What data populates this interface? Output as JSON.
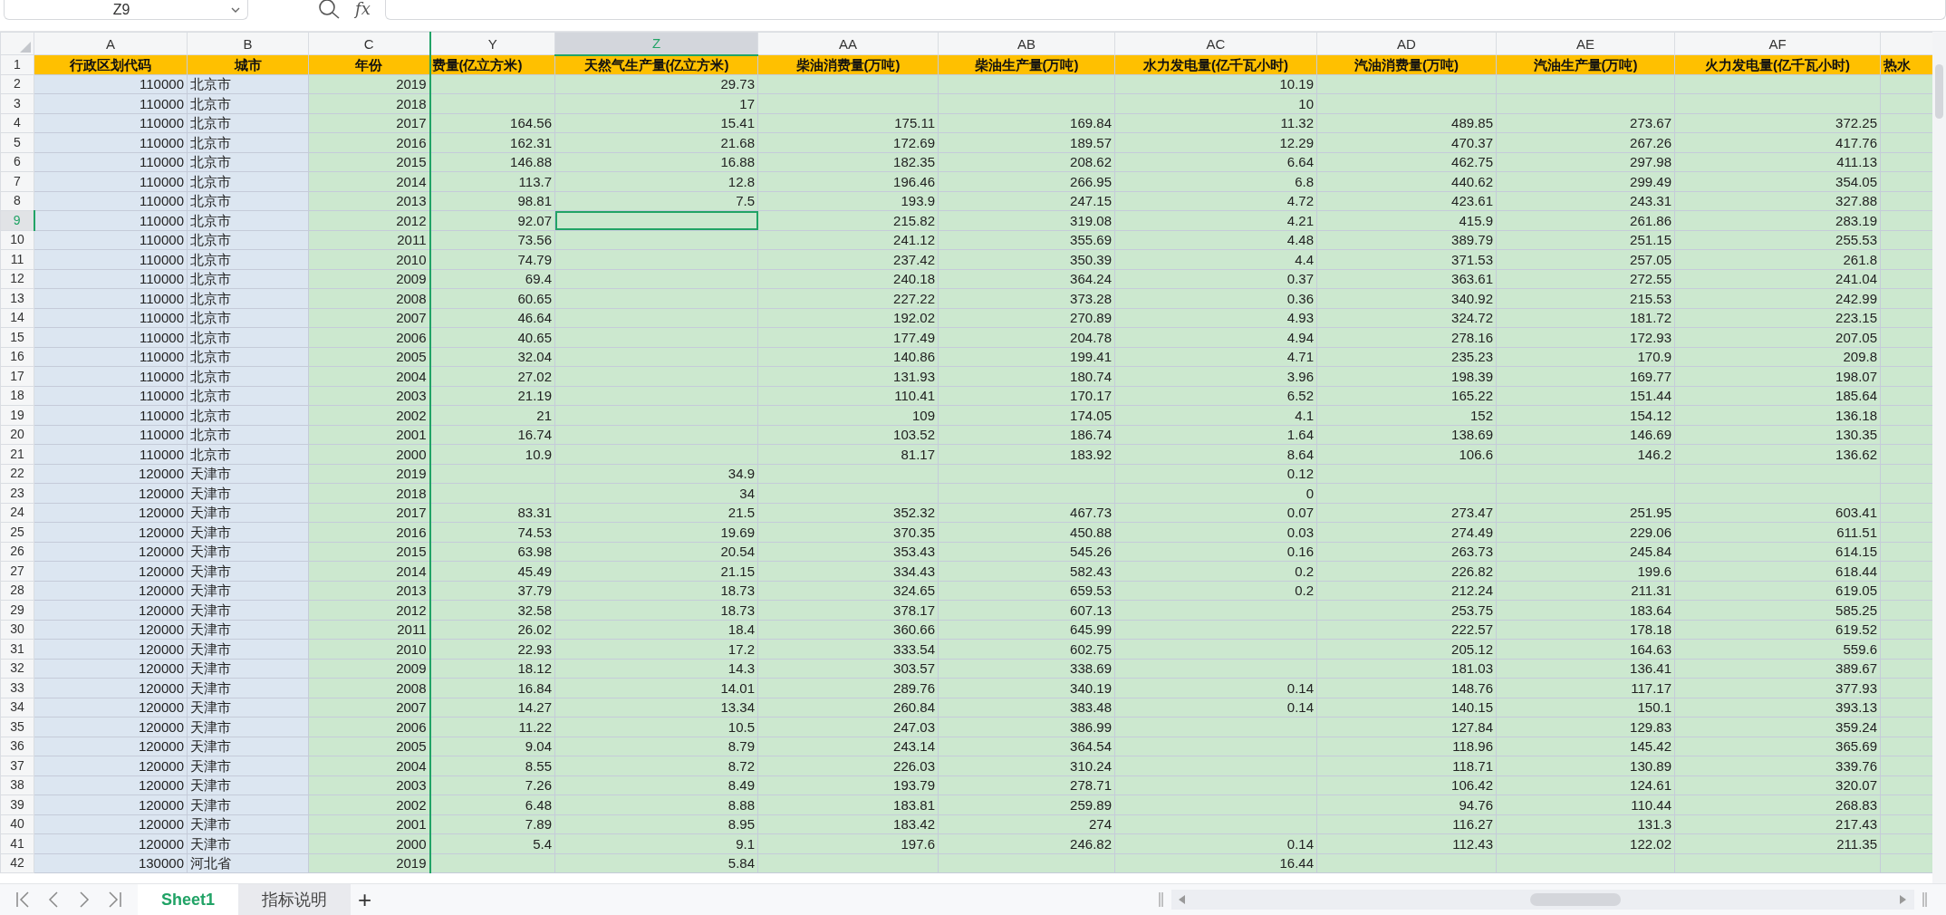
{
  "name_box": {
    "value": "Z9"
  },
  "formula_label": "fx",
  "columns": [
    {
      "letter": "A",
      "selected": false
    },
    {
      "letter": "B",
      "selected": false
    },
    {
      "letter": "C",
      "selected": false
    },
    {
      "letter": "Y",
      "selected": false
    },
    {
      "letter": "Z",
      "selected": true
    },
    {
      "letter": "AA",
      "selected": false
    },
    {
      "letter": "AB",
      "selected": false
    },
    {
      "letter": "AC",
      "selected": false
    },
    {
      "letter": "AD",
      "selected": false
    },
    {
      "letter": "AE",
      "selected": false
    },
    {
      "letter": "AF",
      "selected": false
    }
  ],
  "header_row": {
    "number": "1",
    "cells": [
      "行政区划代码",
      "城市",
      "年份",
      "费量(亿立方米)",
      "天然气生产量(亿立方米)",
      "柴油消费量(万吨)",
      "柴油生产量(万吨)",
      "水力发电量(亿千瓦小时)",
      "汽油消费量(万吨)",
      "汽油生产量(万吨)",
      "火力发电量(亿千瓦小时)",
      "热水"
    ]
  },
  "rows": [
    {
      "number": "2",
      "selected": false,
      "cells": [
        "110000",
        "北京市",
        "2019",
        null,
        "29.73",
        null,
        null,
        "10.19",
        null,
        null,
        null
      ]
    },
    {
      "number": "3",
      "selected": false,
      "cells": [
        "110000",
        "北京市",
        "2018",
        null,
        "17",
        null,
        null,
        "10",
        null,
        null,
        null
      ]
    },
    {
      "number": "4",
      "selected": false,
      "cells": [
        "110000",
        "北京市",
        "2017",
        "164.56",
        "15.41",
        "175.11",
        "169.84",
        "11.32",
        "489.85",
        "273.67",
        "372.25"
      ]
    },
    {
      "number": "5",
      "selected": false,
      "cells": [
        "110000",
        "北京市",
        "2016",
        "162.31",
        "21.68",
        "172.69",
        "189.57",
        "12.29",
        "470.37",
        "267.26",
        "417.76"
      ]
    },
    {
      "number": "6",
      "selected": false,
      "cells": [
        "110000",
        "北京市",
        "2015",
        "146.88",
        "16.88",
        "182.35",
        "208.62",
        "6.64",
        "462.75",
        "297.98",
        "411.13"
      ]
    },
    {
      "number": "7",
      "selected": false,
      "cells": [
        "110000",
        "北京市",
        "2014",
        "113.7",
        "12.8",
        "196.46",
        "266.95",
        "6.8",
        "440.62",
        "299.49",
        "354.05"
      ]
    },
    {
      "number": "8",
      "selected": false,
      "cells": [
        "110000",
        "北京市",
        "2013",
        "98.81",
        "7.5",
        "193.9",
        "247.15",
        "4.72",
        "423.61",
        "243.31",
        "327.88"
      ]
    },
    {
      "number": "9",
      "selected": true,
      "cells": [
        "110000",
        "北京市",
        "2012",
        "92.07",
        null,
        "215.82",
        "319.08",
        "4.21",
        "415.9",
        "261.86",
        "283.19"
      ]
    },
    {
      "number": "10",
      "selected": false,
      "cells": [
        "110000",
        "北京市",
        "2011",
        "73.56",
        null,
        "241.12",
        "355.69",
        "4.48",
        "389.79",
        "251.15",
        "255.53"
      ]
    },
    {
      "number": "11",
      "selected": false,
      "cells": [
        "110000",
        "北京市",
        "2010",
        "74.79",
        null,
        "237.42",
        "350.39",
        "4.4",
        "371.53",
        "257.05",
        "261.8"
      ]
    },
    {
      "number": "12",
      "selected": false,
      "cells": [
        "110000",
        "北京市",
        "2009",
        "69.4",
        null,
        "240.18",
        "364.24",
        "0.37",
        "363.61",
        "272.55",
        "241.04"
      ]
    },
    {
      "number": "13",
      "selected": false,
      "cells": [
        "110000",
        "北京市",
        "2008",
        "60.65",
        null,
        "227.22",
        "373.28",
        "0.36",
        "340.92",
        "215.53",
        "242.99"
      ]
    },
    {
      "number": "14",
      "selected": false,
      "cells": [
        "110000",
        "北京市",
        "2007",
        "46.64",
        null,
        "192.02",
        "270.89",
        "4.93",
        "324.72",
        "181.72",
        "223.15"
      ]
    },
    {
      "number": "15",
      "selected": false,
      "cells": [
        "110000",
        "北京市",
        "2006",
        "40.65",
        null,
        "177.49",
        "204.78",
        "4.94",
        "278.16",
        "172.93",
        "207.05"
      ]
    },
    {
      "number": "16",
      "selected": false,
      "cells": [
        "110000",
        "北京市",
        "2005",
        "32.04",
        null,
        "140.86",
        "199.41",
        "4.71",
        "235.23",
        "170.9",
        "209.8"
      ]
    },
    {
      "number": "17",
      "selected": false,
      "cells": [
        "110000",
        "北京市",
        "2004",
        "27.02",
        null,
        "131.93",
        "180.74",
        "3.96",
        "198.39",
        "169.77",
        "198.07"
      ]
    },
    {
      "number": "18",
      "selected": false,
      "cells": [
        "110000",
        "北京市",
        "2003",
        "21.19",
        null,
        "110.41",
        "170.17",
        "6.52",
        "165.22",
        "151.44",
        "185.64"
      ]
    },
    {
      "number": "19",
      "selected": false,
      "cells": [
        "110000",
        "北京市",
        "2002",
        "21",
        null,
        "109",
        "174.05",
        "4.1",
        "152",
        "154.12",
        "136.18"
      ]
    },
    {
      "number": "20",
      "selected": false,
      "cells": [
        "110000",
        "北京市",
        "2001",
        "16.74",
        null,
        "103.52",
        "186.74",
        "1.64",
        "138.69",
        "146.69",
        "130.35"
      ]
    },
    {
      "number": "21",
      "selected": false,
      "cells": [
        "110000",
        "北京市",
        "2000",
        "10.9",
        null,
        "81.17",
        "183.92",
        "8.64",
        "106.6",
        "146.2",
        "136.62"
      ]
    },
    {
      "number": "22",
      "selected": false,
      "cells": [
        "120000",
        "天津市",
        "2019",
        null,
        "34.9",
        null,
        null,
        "0.12",
        null,
        null,
        null
      ]
    },
    {
      "number": "23",
      "selected": false,
      "cells": [
        "120000",
        "天津市",
        "2018",
        null,
        "34",
        null,
        null,
        "0",
        null,
        null,
        null
      ]
    },
    {
      "number": "24",
      "selected": false,
      "cells": [
        "120000",
        "天津市",
        "2017",
        "83.31",
        "21.5",
        "352.32",
        "467.73",
        "0.07",
        "273.47",
        "251.95",
        "603.41"
      ]
    },
    {
      "number": "25",
      "selected": false,
      "cells": [
        "120000",
        "天津市",
        "2016",
        "74.53",
        "19.69",
        "370.35",
        "450.88",
        "0.03",
        "274.49",
        "229.06",
        "611.51"
      ]
    },
    {
      "number": "26",
      "selected": false,
      "cells": [
        "120000",
        "天津市",
        "2015",
        "63.98",
        "20.54",
        "353.43",
        "545.26",
        "0.16",
        "263.73",
        "245.84",
        "614.15"
      ]
    },
    {
      "number": "27",
      "selected": false,
      "cells": [
        "120000",
        "天津市",
        "2014",
        "45.49",
        "21.15",
        "334.43",
        "582.43",
        "0.2",
        "226.82",
        "199.6",
        "618.44"
      ]
    },
    {
      "number": "28",
      "selected": false,
      "cells": [
        "120000",
        "天津市",
        "2013",
        "37.79",
        "18.73",
        "324.65",
        "659.53",
        "0.2",
        "212.24",
        "211.31",
        "619.05"
      ]
    },
    {
      "number": "29",
      "selected": false,
      "cells": [
        "120000",
        "天津市",
        "2012",
        "32.58",
        "18.73",
        "378.17",
        "607.13",
        null,
        "253.75",
        "183.64",
        "585.25"
      ]
    },
    {
      "number": "30",
      "selected": false,
      "cells": [
        "120000",
        "天津市",
        "2011",
        "26.02",
        "18.4",
        "360.66",
        "645.99",
        null,
        "222.57",
        "178.18",
        "619.52"
      ]
    },
    {
      "number": "31",
      "selected": false,
      "cells": [
        "120000",
        "天津市",
        "2010",
        "22.93",
        "17.2",
        "333.54",
        "602.75",
        null,
        "205.12",
        "164.63",
        "559.6"
      ]
    },
    {
      "number": "32",
      "selected": false,
      "cells": [
        "120000",
        "天津市",
        "2009",
        "18.12",
        "14.3",
        "303.57",
        "338.69",
        null,
        "181.03",
        "136.41",
        "389.67"
      ]
    },
    {
      "number": "33",
      "selected": false,
      "cells": [
        "120000",
        "天津市",
        "2008",
        "16.84",
        "14.01",
        "289.76",
        "340.19",
        "0.14",
        "148.76",
        "117.17",
        "377.93"
      ]
    },
    {
      "number": "34",
      "selected": false,
      "cells": [
        "120000",
        "天津市",
        "2007",
        "14.27",
        "13.34",
        "260.84",
        "383.48",
        "0.14",
        "140.15",
        "150.1",
        "393.13"
      ]
    },
    {
      "number": "35",
      "selected": false,
      "cells": [
        "120000",
        "天津市",
        "2006",
        "11.22",
        "10.5",
        "247.03",
        "386.99",
        null,
        "127.84",
        "129.83",
        "359.24"
      ]
    },
    {
      "number": "36",
      "selected": false,
      "cells": [
        "120000",
        "天津市",
        "2005",
        "9.04",
        "8.79",
        "243.14",
        "364.54",
        null,
        "118.96",
        "145.42",
        "365.69"
      ]
    },
    {
      "number": "37",
      "selected": false,
      "cells": [
        "120000",
        "天津市",
        "2004",
        "8.55",
        "8.72",
        "226.03",
        "310.24",
        null,
        "118.71",
        "130.89",
        "339.76"
      ]
    },
    {
      "number": "38",
      "selected": false,
      "cells": [
        "120000",
        "天津市",
        "2003",
        "7.26",
        "8.49",
        "193.79",
        "278.71",
        null,
        "106.42",
        "124.61",
        "320.07"
      ]
    },
    {
      "number": "39",
      "selected": false,
      "cells": [
        "120000",
        "天津市",
        "2002",
        "6.48",
        "8.88",
        "183.81",
        "259.89",
        null,
        "94.76",
        "110.44",
        "268.83"
      ]
    },
    {
      "number": "40",
      "selected": false,
      "cells": [
        "120000",
        "天津市",
        "2001",
        "7.89",
        "8.95",
        "183.42",
        "274",
        null,
        "116.27",
        "131.3",
        "217.43"
      ]
    },
    {
      "number": "41",
      "selected": false,
      "cells": [
        "120000",
        "天津市",
        "2000",
        "5.4",
        "9.1",
        "197.6",
        "246.82",
        "0.14",
        "112.43",
        "122.02",
        "211.35"
      ]
    },
    {
      "number": "42",
      "selected": false,
      "cells": [
        "130000",
        "河北省",
        "2019",
        null,
        "5.84",
        null,
        null,
        "16.44",
        null,
        null,
        null
      ]
    }
  ],
  "sheet_tabs": [
    {
      "label": "Sheet1",
      "selected": true
    },
    {
      "label": "指标说明",
      "selected": false
    }
  ],
  "add_sheet_button": "+"
}
